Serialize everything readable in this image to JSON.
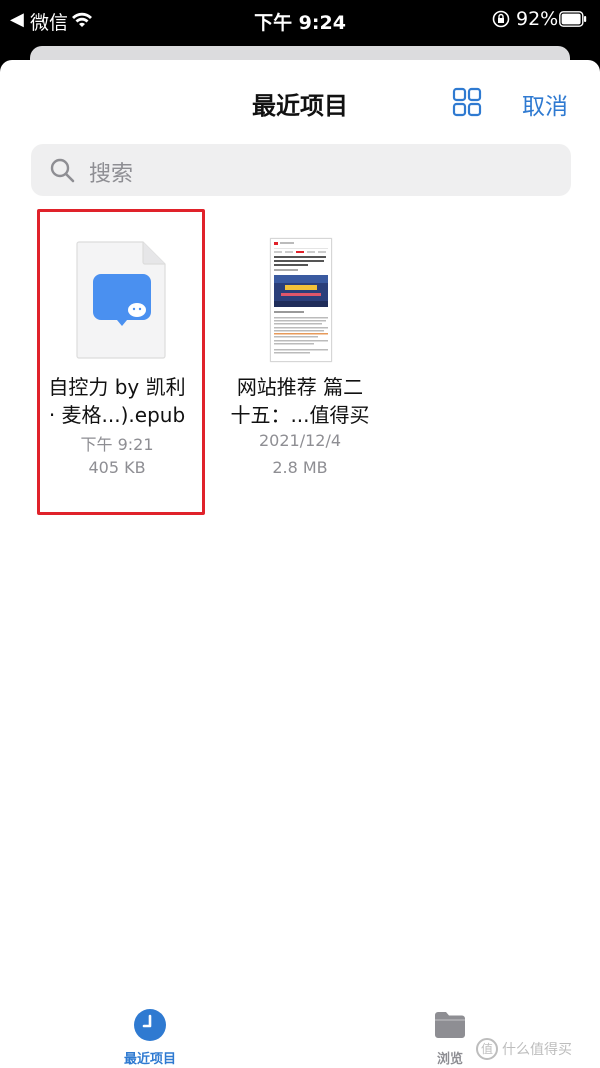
{
  "status_bar": {
    "back_glyph": "◀",
    "carrier": "微信",
    "time": "下午 9:24",
    "battery_percent": "92%",
    "icons": [
      "wifi-icon",
      "lock-rotation-icon",
      "battery-icon"
    ]
  },
  "nav": {
    "title": "最近项目",
    "cancel_label": "取消",
    "grid_icon": "grid-view-icon",
    "accent_color": "#2f7ad1"
  },
  "search": {
    "placeholder": "搜索",
    "icon": "search-icon"
  },
  "files": [
    {
      "name_line1": "自控力 by 凯利",
      "name_line2": "· 麦格...).epub",
      "date": "下午 9:21",
      "size": "405 KB",
      "icon": "wechat-document-icon",
      "selected": true
    },
    {
      "name_line1": "网站推荐 篇二",
      "name_line2": "十五：...值得买",
      "date": "2021/12/4",
      "size": "2.8 MB",
      "icon": "webpage-thumbnail",
      "selected": false
    }
  ],
  "tab_bar": {
    "recent_label": "最近项目",
    "browse_label": "浏览",
    "recent_icon": "clock-icon",
    "browse_icon": "folder-icon"
  },
  "watermark": {
    "glyph": "值",
    "text": "什么值得买"
  }
}
